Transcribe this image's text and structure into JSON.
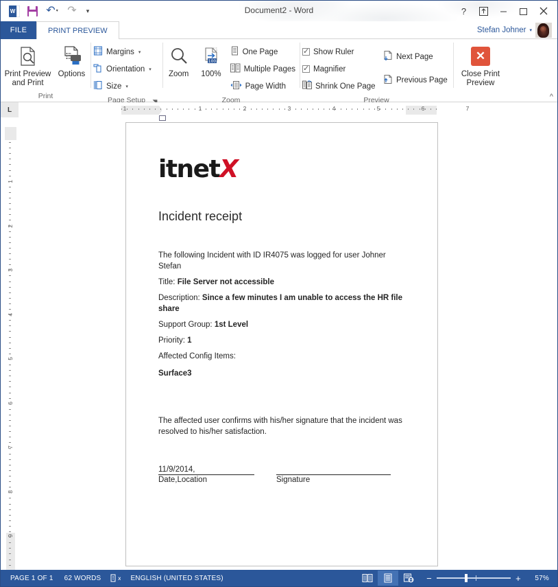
{
  "window": {
    "title": "Document2 - Word",
    "help_label": "?",
    "ribbon_display_label": "ribbon-display-options",
    "minimize_label": "–",
    "restore_label": "❐",
    "close_label": "✕"
  },
  "quick_access": {
    "word_icon": "word-icon",
    "save_label": "save-icon",
    "undo_label": "undo-icon",
    "redo_label": "redo-icon",
    "customize_label": "customize-quick-access-toolbar-icon"
  },
  "tabs": {
    "file": "FILE",
    "active": "PRINT PREVIEW"
  },
  "account": {
    "name": "Stefan Johner",
    "caret": "▾"
  },
  "ribbon": {
    "collapse_icon": "^",
    "groups": [
      {
        "label": "Print",
        "items": [
          {
            "label": "Print Preview\nand Print",
            "icon": "print-preview-icon"
          },
          {
            "label": "Options",
            "icon": "printer-options-icon"
          }
        ]
      },
      {
        "label": "Page Setup",
        "dialog_launcher": "◥",
        "items": [
          {
            "label": "Margins",
            "icon": "margins-icon",
            "caret": "▾"
          },
          {
            "label": "Orientation",
            "icon": "orientation-icon",
            "caret": "▾"
          },
          {
            "label": "Size",
            "icon": "size-icon",
            "caret": "▾"
          }
        ]
      },
      {
        "label": "Zoom",
        "items": [
          {
            "label": "Zoom",
            "icon": "magnifier-icon"
          },
          {
            "label": "100%",
            "icon": "zoom-100-icon"
          },
          {
            "label": "One Page",
            "icon": "one-page-icon"
          },
          {
            "label": "Multiple Pages",
            "icon": "multiple-pages-icon"
          },
          {
            "label": "Page Width",
            "icon": "page-width-icon"
          }
        ]
      },
      {
        "label": "Preview",
        "items": [
          {
            "label": "Show Ruler",
            "checked": true
          },
          {
            "label": "Magnifier",
            "checked": true
          },
          {
            "label": "Shrink One Page",
            "icon": "shrink-one-page-icon"
          },
          {
            "label": "Next Page",
            "icon": "next-page-icon"
          },
          {
            "label": "Previous Page",
            "icon": "previous-page-icon"
          }
        ]
      },
      {
        "label": "",
        "items": [
          {
            "label": "Close Print\nPreview",
            "icon": "close-print-preview-icon"
          }
        ]
      }
    ],
    "labels": {
      "print": "Print",
      "page_setup": "Page Setup",
      "zoom": "Zoom",
      "preview": "Preview",
      "print_preview_and_print": "Print Preview and Print",
      "print_preview_line1": "Print Preview",
      "print_preview_line2": "and Print",
      "options": "Options",
      "margins": "Margins",
      "orientation": "Orientation",
      "size": "Size",
      "zoom_btn": "Zoom",
      "zoom_100": "100%",
      "one_page": "One Page",
      "multiple_pages": "Multiple Pages",
      "page_width": "Page Width",
      "show_ruler": "Show Ruler",
      "magnifier": "Magnifier",
      "shrink_one_page": "Shrink One Page",
      "next_page": "Next Page",
      "previous_page": "Previous Page",
      "close_print_line1": "Close Print",
      "close_print_line2": "Preview"
    }
  },
  "ruler": {
    "corner_tab_label": "L",
    "h_numbers": [
      "1",
      "1",
      "2",
      "3",
      "4",
      "5",
      "6",
      "7"
    ],
    "v_numbers": [
      "1",
      "2",
      "3",
      "4",
      "5",
      "6",
      "7",
      "8",
      "9"
    ]
  },
  "document": {
    "logo_black": "itnet",
    "logo_red": "X",
    "heading": "Incident receipt",
    "intro": "The following Incident with ID IR4075 was logged for user Johner Stefan",
    "fields": [
      {
        "label": "Title: ",
        "value": "File Server not accessible"
      },
      {
        "label": "Description: ",
        "value": "Since a few minutes I am unable to access the HR file share"
      },
      {
        "label": "Support Group: ",
        "value": "1st Level"
      },
      {
        "label": "Priority: ",
        "value": "1"
      }
    ],
    "config_items_label": "Affected Config Items:",
    "config_items_value": "Surface3",
    "confirmation": "The affected user confirms with his/her signature that the incident was resolved to his/her satisfaction.",
    "date_value": "11/9/2014,",
    "date_caption": "Date,Location",
    "signature_blank": "",
    "signature_caption": "Signature"
  },
  "status_bar": {
    "page": "PAGE 1 OF 1",
    "words": "62 WORDS",
    "proofing_icon": "proofing-errors-icon",
    "language": "ENGLISH (UNITED STATES)",
    "view_read_mode": "read-mode-icon",
    "view_print_layout": "print-layout-icon",
    "view_web_layout": "web-layout-icon",
    "zoom_out": "−",
    "zoom_in": "+",
    "zoom_level": "57%"
  },
  "colors": {
    "word_blue": "#2b579a",
    "accent_red": "#e0543b",
    "logo_red": "#cf1126",
    "status_bar": "#2b579a"
  }
}
